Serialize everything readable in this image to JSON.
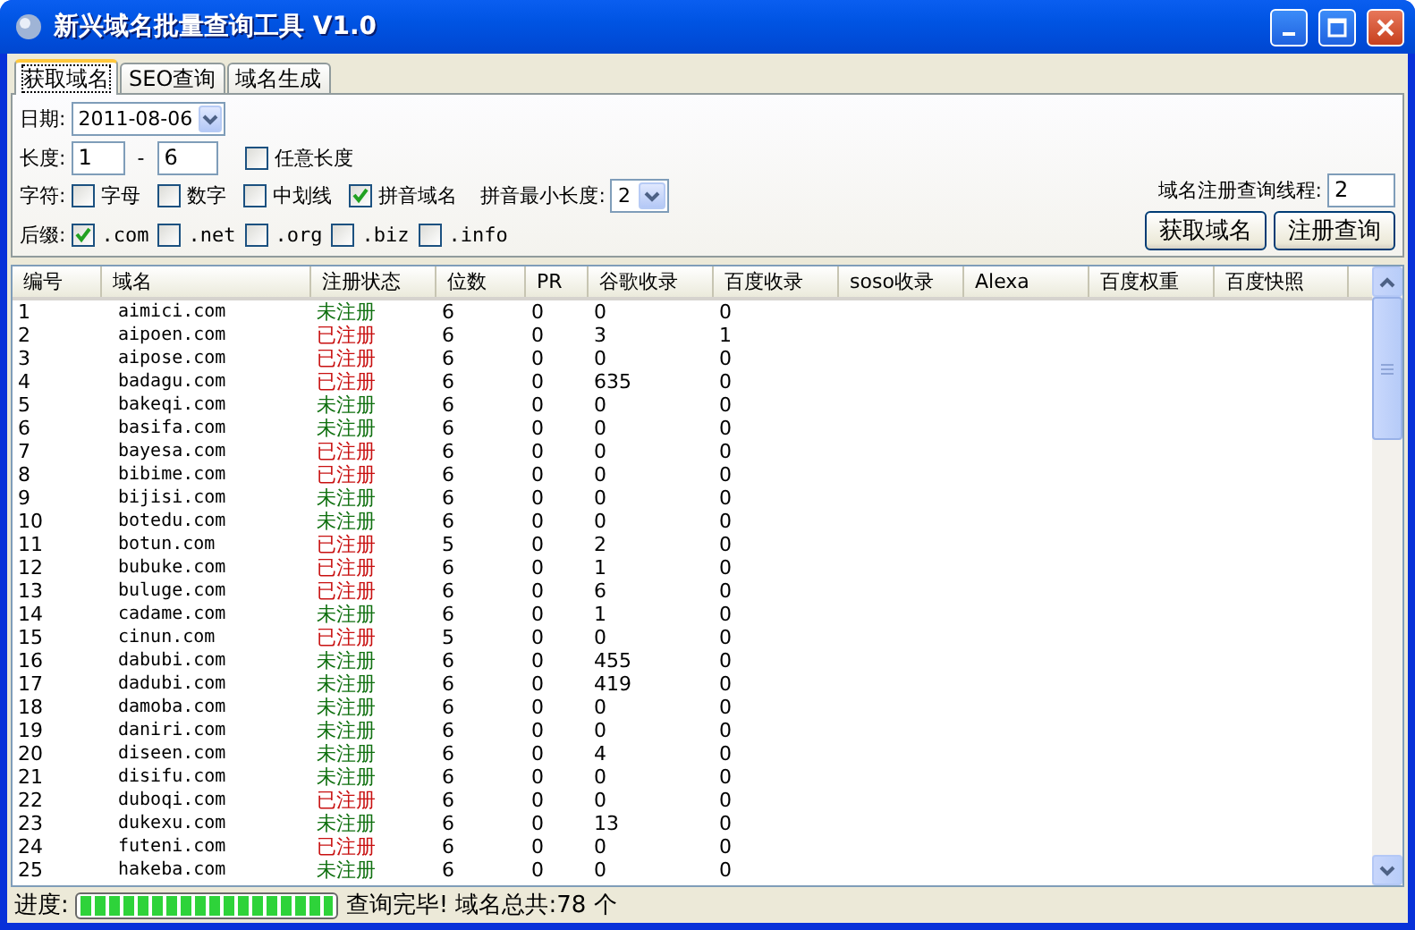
{
  "window": {
    "title": "新兴域名批量查询工具 V1.0"
  },
  "tabs": [
    {
      "label": "获取域名",
      "selected": true
    },
    {
      "label": "SEO查询",
      "selected": false
    },
    {
      "label": "域名生成",
      "selected": false
    }
  ],
  "form": {
    "date_label": "日期:",
    "date": "2011-08-06",
    "length_label": "长度:",
    "length_min": "1",
    "length_sep": "-",
    "length_max": "6",
    "any_length": {
      "label": "任意长度",
      "checked": false
    },
    "chars_label": "字符:",
    "chars": [
      {
        "label": "字母",
        "checked": false
      },
      {
        "label": "数字",
        "checked": false
      },
      {
        "label": "中划线",
        "checked": false
      },
      {
        "label": "拼音域名",
        "checked": true
      }
    ],
    "pinyin_min_label": "拼音最小长度:",
    "pinyin_min": "2",
    "suffix_label": "后缀:",
    "suffixes": [
      {
        "label": ".com",
        "checked": true
      },
      {
        "label": ".net",
        "checked": false
      },
      {
        "label": ".org",
        "checked": false
      },
      {
        "label": ".biz",
        "checked": false
      },
      {
        "label": ".info",
        "checked": false
      }
    ],
    "threads_label": "域名注册查询线程:",
    "threads": "2",
    "buttons": [
      "获取域名",
      "注册查询"
    ]
  },
  "table": {
    "columns": [
      "编号",
      "域名",
      "注册状态",
      "位数",
      "PR",
      "谷歌收录",
      "百度收录",
      "soso收录",
      "Alexa",
      "百度权重",
      "百度快照"
    ],
    "rows": [
      {
        "cells": [
          "1",
          "aimici.com",
          "未注册",
          "6",
          "0",
          "0",
          "0"
        ],
        "registered": false
      },
      {
        "cells": [
          "2",
          "aipoen.com",
          "已注册",
          "6",
          "0",
          "3",
          "1"
        ],
        "registered": true
      },
      {
        "cells": [
          "3",
          "aipose.com",
          "已注册",
          "6",
          "0",
          "0",
          "0"
        ],
        "registered": true
      },
      {
        "cells": [
          "4",
          "badagu.com",
          "已注册",
          "6",
          "0",
          "635",
          "0"
        ],
        "registered": true
      },
      {
        "cells": [
          "5",
          "bakeqi.com",
          "未注册",
          "6",
          "0",
          "0",
          "0"
        ],
        "registered": false
      },
      {
        "cells": [
          "6",
          "basifa.com",
          "未注册",
          "6",
          "0",
          "0",
          "0"
        ],
        "registered": false
      },
      {
        "cells": [
          "7",
          "bayesa.com",
          "已注册",
          "6",
          "0",
          "0",
          "0"
        ],
        "registered": true
      },
      {
        "cells": [
          "8",
          "bibime.com",
          "已注册",
          "6",
          "0",
          "0",
          "0"
        ],
        "registered": true
      },
      {
        "cells": [
          "9",
          "bijisi.com",
          "未注册",
          "6",
          "0",
          "0",
          "0"
        ],
        "registered": false
      },
      {
        "cells": [
          "10",
          "botedu.com",
          "未注册",
          "6",
          "0",
          "0",
          "0"
        ],
        "registered": false
      },
      {
        "cells": [
          "11",
          "botun.com",
          "已注册",
          "5",
          "0",
          "2",
          "0"
        ],
        "registered": true
      },
      {
        "cells": [
          "12",
          "bubuke.com",
          "已注册",
          "6",
          "0",
          "1",
          "0"
        ],
        "registered": true
      },
      {
        "cells": [
          "13",
          "buluge.com",
          "已注册",
          "6",
          "0",
          "6",
          "0"
        ],
        "registered": true
      },
      {
        "cells": [
          "14",
          "cadame.com",
          "未注册",
          "6",
          "0",
          "1",
          "0"
        ],
        "registered": false
      },
      {
        "cells": [
          "15",
          "cinun.com",
          "已注册",
          "5",
          "0",
          "0",
          "0"
        ],
        "registered": true
      },
      {
        "cells": [
          "16",
          "dabubi.com",
          "未注册",
          "6",
          "0",
          "455",
          "0"
        ],
        "registered": false
      },
      {
        "cells": [
          "17",
          "dadubi.com",
          "未注册",
          "6",
          "0",
          "419",
          "0"
        ],
        "registered": false
      },
      {
        "cells": [
          "18",
          "damoba.com",
          "未注册",
          "6",
          "0",
          "0",
          "0"
        ],
        "registered": false
      },
      {
        "cells": [
          "19",
          "daniri.com",
          "未注册",
          "6",
          "0",
          "0",
          "0"
        ],
        "registered": false
      },
      {
        "cells": [
          "20",
          "diseen.com",
          "未注册",
          "6",
          "0",
          "4",
          "0"
        ],
        "registered": false
      },
      {
        "cells": [
          "21",
          "disifu.com",
          "未注册",
          "6",
          "0",
          "0",
          "0"
        ],
        "registered": false
      },
      {
        "cells": [
          "22",
          "duboqi.com",
          "已注册",
          "6",
          "0",
          "0",
          "0"
        ],
        "registered": true
      },
      {
        "cells": [
          "23",
          "dukexu.com",
          "未注册",
          "6",
          "0",
          "13",
          "0"
        ],
        "registered": false
      },
      {
        "cells": [
          "24",
          "futeni.com",
          "已注册",
          "6",
          "0",
          "0",
          "0"
        ],
        "registered": true
      },
      {
        "cells": [
          "25",
          "hakeba.com",
          "未注册",
          "6",
          "0",
          "0",
          "0"
        ],
        "registered": false
      }
    ]
  },
  "status_bar": {
    "progress_label": "进度:",
    "progress": {
      "level": 1
    },
    "message": "查询完毕! 域名总共:78 个"
  }
}
